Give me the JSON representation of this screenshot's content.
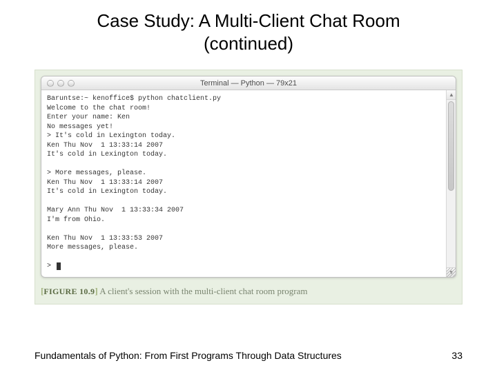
{
  "title_line1": "Case Study: A Multi-Client Chat Room",
  "title_line2": "(continued)",
  "terminal": {
    "window_title": "Terminal — Python — 79x21",
    "lines": [
      "Baruntse:~ kenoffice$ python chatclient.py",
      "Welcome to the chat room!",
      "Enter your name: Ken",
      "No messages yet!",
      "> It's cold in Lexington today.",
      "Ken Thu Nov  1 13:33:14 2007",
      "It's cold in Lexington today.",
      "",
      "> More messages, please.",
      "Ken Thu Nov  1 13:33:14 2007",
      "It's cold in Lexington today.",
      "",
      "Mary Ann Thu Nov  1 13:33:34 2007",
      "I'm from Ohio.",
      "",
      "Ken Thu Nov  1 13:33:53 2007",
      "More messages, please.",
      "",
      "> "
    ]
  },
  "caption": {
    "label": "FIGURE 10.9",
    "text": "A client's session with the multi-client chat room program"
  },
  "footer": {
    "book": "Fundamentals of Python: From First Programs Through Data Structures",
    "page": "33"
  }
}
